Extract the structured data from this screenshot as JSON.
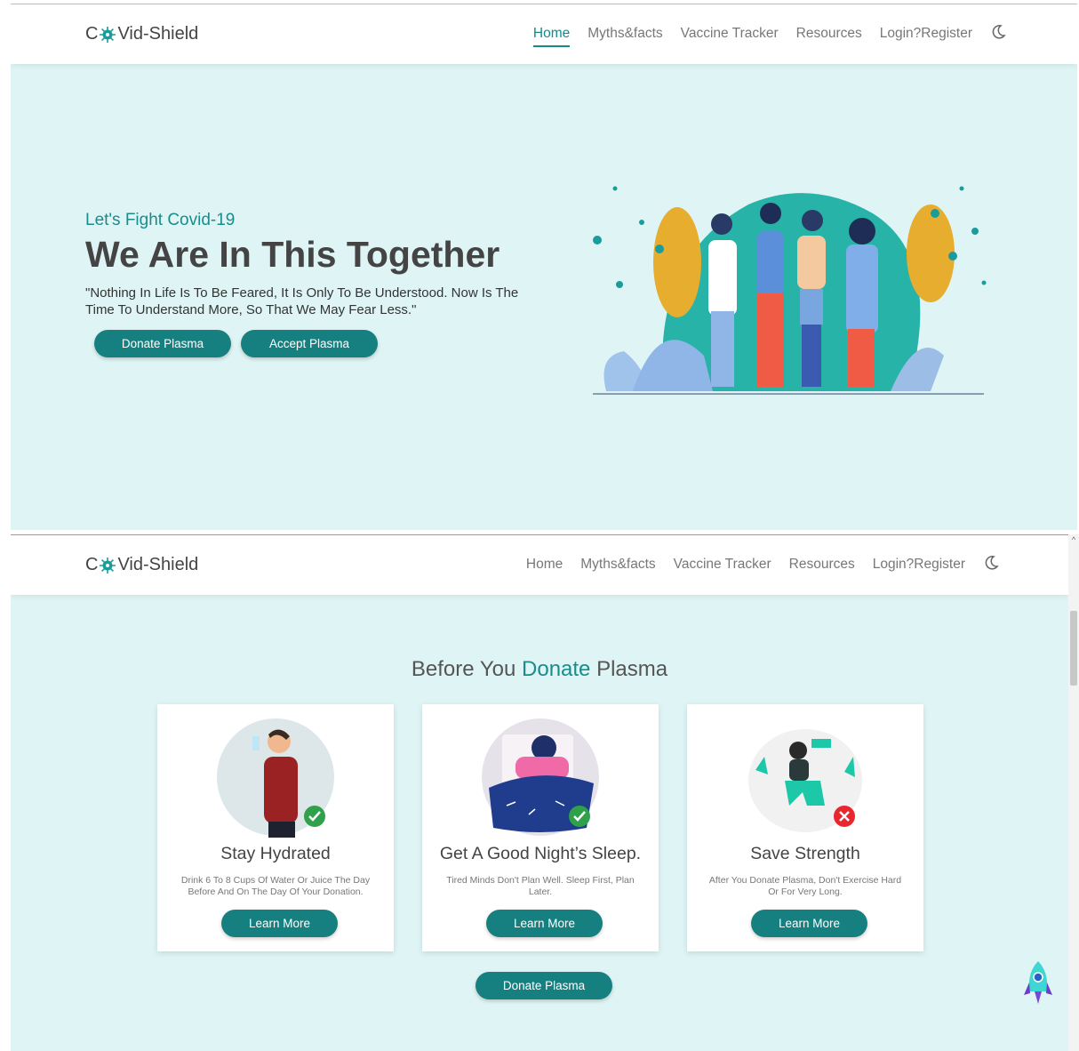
{
  "brand": {
    "prefix": "C",
    "suffix": "Vid-Shield"
  },
  "nav": {
    "items": [
      {
        "label": "Home"
      },
      {
        "label": "Myths&facts"
      },
      {
        "label": "Vaccine Tracker"
      },
      {
        "label": "Resources"
      },
      {
        "label": "Login?Register"
      }
    ]
  },
  "hero": {
    "subtitle": "Let's Fight Covid-19",
    "title": "We Are In This Together",
    "quote": "\"Nothing In Life Is To Be Feared, It Is Only To Be Understood. Now Is The Time To Understand More, So That We May Fear Less.\"",
    "donate_label": "Donate Plasma",
    "accept_label": "Accept Plasma"
  },
  "section": {
    "title_before": "Before You ",
    "title_highlight": "Donate",
    "title_after": " Plasma",
    "cards": [
      {
        "title": "Stay Hydrated",
        "text": "Drink 6 To 8 Cups Of Water Or Juice The Day Before And On The Day Of Your Donation.",
        "button": "Learn More"
      },
      {
        "title": "Get A Good Night’s Sleep.",
        "text": "Tired Minds Don't Plan Well. Sleep First, Plan Later.",
        "button": "Learn More"
      },
      {
        "title": "Save Strength",
        "text": "After You Donate Plasma, Don't Exercise Hard Or For Very Long.",
        "button": "Learn More"
      }
    ],
    "donate_label": "Donate Plasma"
  },
  "colors": {
    "accent": "#148a8a",
    "button": "#168080",
    "background": "#dff5f5"
  },
  "icons": [
    "virus-icon",
    "moon-icon",
    "check-icon",
    "cross-icon",
    "rocket-icon"
  ]
}
